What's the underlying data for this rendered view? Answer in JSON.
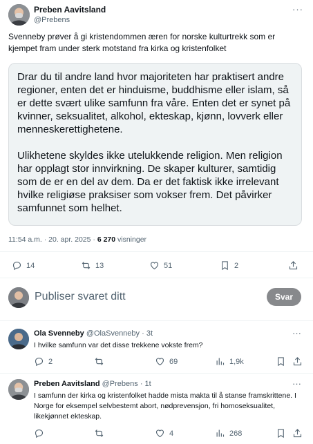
{
  "main_tweet": {
    "author_name": "Preben Aavitsland",
    "handle": "@Prebens",
    "text": "Svenneby prøver å gi kristendommen æren for norske kulturtrekk som er kjempet fram under sterk motstand fra kirka og kristenfolket",
    "quote_paragraph_1": "Drar du til andre land hvor majoriteten har praktisert andre regioner, enten det er hinduisme, buddhisme eller islam, så er dette svært ulike samfunn fra våre. Enten det er synet på kvinner, seksualitet, alkohol, ekteskap, kjønn, lovverk eller menneskerettighetene.",
    "quote_paragraph_2": "Ulikhetene skyldes ikke utelukkende religion. Men religion har opplagt stor innvirkning. De skaper kulturer, samtidig som de er en del av dem. Da er det faktisk ikke irrelevant hvilke religiøse praksiser som vokser frem. Det påvirker samfunnet som helhet.",
    "meta_time": "11:54 a.m. · 20. apr. 2025 · ",
    "views_count": "6 270",
    "views_label": " visninger",
    "replies": "14",
    "reposts": "13",
    "likes": "51",
    "bookmarks": "2",
    "more_icon": "ellipsis-icon"
  },
  "reply_box": {
    "placeholder": "Publiser svaret ditt",
    "button_label": "Svar"
  },
  "replies": [
    {
      "author_name": "Ola Svenneby",
      "handle": "@OlaSvenneby",
      "time": " · 3t",
      "text": "I hvilke samfunn var det disse trekkene vokste frem?",
      "replies": "2",
      "reposts": "",
      "likes": "69",
      "views": "1,9k"
    },
    {
      "author_name": "Preben Aavitsland",
      "handle": "@Prebens",
      "time": " · 1t",
      "text": "I samfunn der kirka og kristenfolket hadde mista makta til å stanse framskrittene. I Norge for eksempel selvbestemt abort, nødprevensjon, fri homoseksualitet, likekjønnet ekteskap.",
      "replies": "",
      "reposts": "",
      "likes": "4",
      "views": "268"
    }
  ],
  "colors": {
    "text": "#0f1419",
    "secondary": "#536471",
    "quote_bg": "#eff3f4",
    "button_bg": "#87898c"
  }
}
